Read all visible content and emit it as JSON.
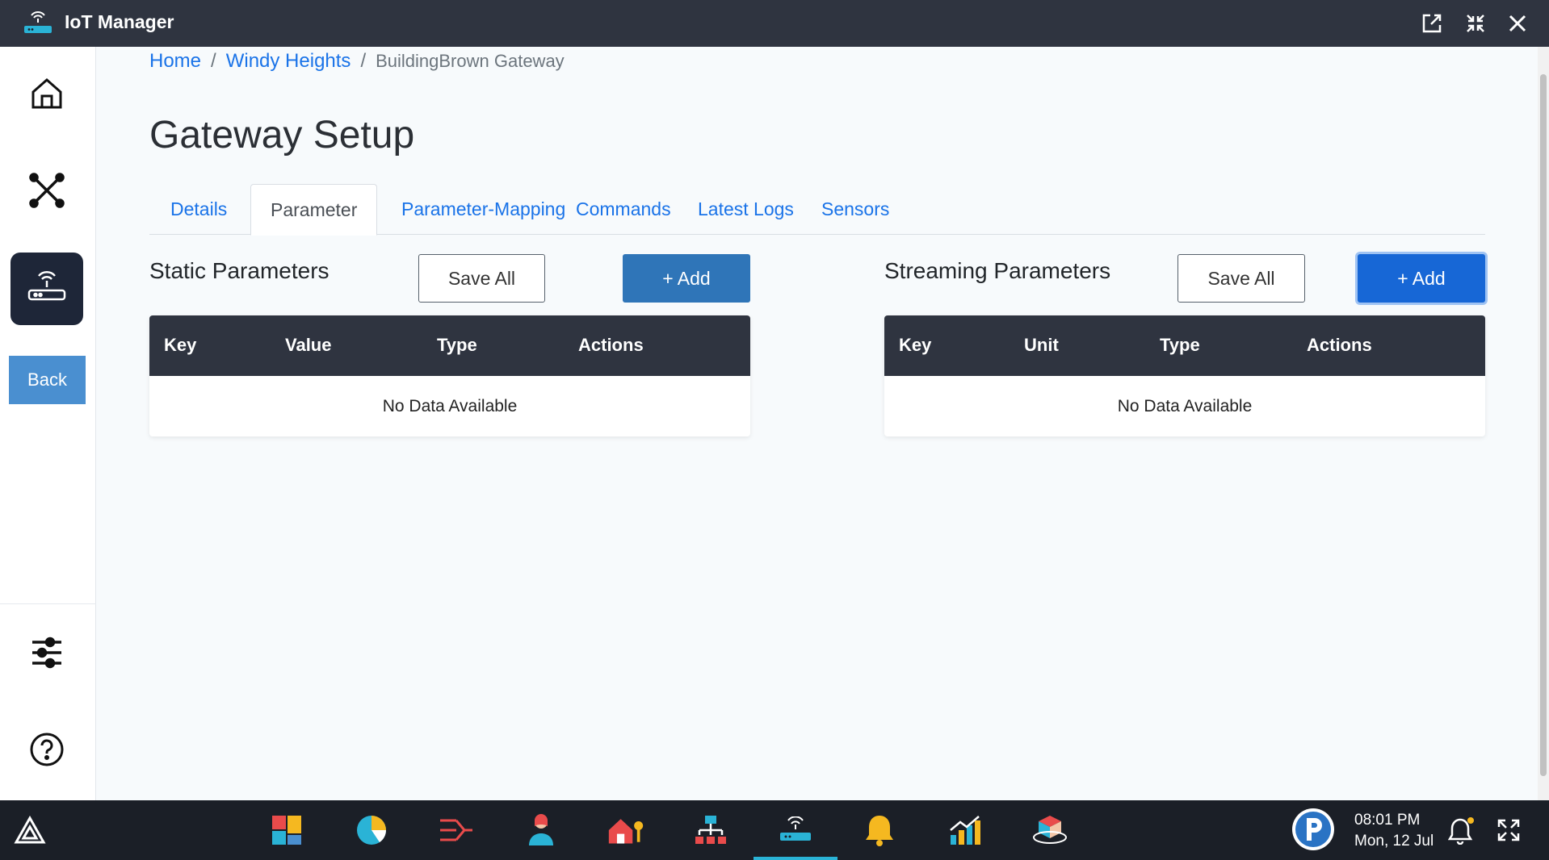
{
  "app": {
    "title": "IoT Manager"
  },
  "breadcrumb": {
    "home": "Home",
    "site": "Windy Heights",
    "current": "BuildingBrown Gateway",
    "separator": "/"
  },
  "page": {
    "title": "Gateway Setup"
  },
  "tabs": [
    {
      "label": "Details"
    },
    {
      "label": "Parameter"
    },
    {
      "label": "Parameter-Mapping"
    },
    {
      "label": "Commands"
    },
    {
      "label": "Latest Logs"
    },
    {
      "label": "Sensors"
    }
  ],
  "active_tab": "Parameter",
  "static": {
    "title": "Static Parameters",
    "save_label": "Save All",
    "add_label": "+ Add",
    "columns": [
      "Key",
      "Value",
      "Type",
      "Actions"
    ],
    "empty_text": "No Data Available"
  },
  "streaming": {
    "title": "Streaming Parameters",
    "save_label": "Save All",
    "add_label": "+ Add",
    "columns": [
      "Key",
      "Unit",
      "Type",
      "Actions"
    ],
    "empty_text": "No Data Available"
  },
  "sidebar": {
    "items": [
      {
        "icon": "home-icon"
      },
      {
        "icon": "network-icon"
      },
      {
        "icon": "gateway-router-icon",
        "active": true
      },
      {
        "icon": "sliders-icon"
      },
      {
        "icon": "help-icon"
      }
    ],
    "back_label": "Back"
  },
  "taskbar": {
    "time": "08:01 PM",
    "date": "Mon, 12 Jul",
    "apps": [
      "dashboard-tiles-icon",
      "pie-chart-icon",
      "flow-icon",
      "person-icon",
      "home-key-icon",
      "hierarchy-icon",
      "gateway-router-icon",
      "bell-app-icon",
      "bar-growth-icon",
      "cube-icon"
    ]
  },
  "colors": {
    "accent": "#1a73e8",
    "primary_button": "#2f75b8",
    "header_dark": "#2f3440",
    "active_tab_underline": "#2ab3d6"
  }
}
